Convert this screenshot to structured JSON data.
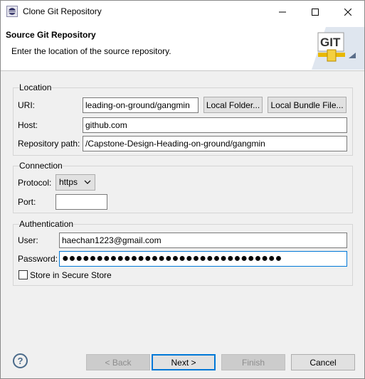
{
  "window": {
    "title": "Clone Git Repository",
    "controls": {
      "minimize": "—",
      "maximize": "☐",
      "close": "✕"
    }
  },
  "header": {
    "title": "Source Git Repository",
    "description": "Enter the location of the source repository.",
    "banner_text": "GIT"
  },
  "location": {
    "group_label": "Location",
    "uri_label": "URI:",
    "uri_value": "leading-on-ground/gangmin",
    "local_folder_button": "Local Folder...",
    "local_bundle_button": "Local Bundle File...",
    "host_label": "Host:",
    "host_value": "github.com",
    "repo_path_label": "Repository path:",
    "repo_path_value": "/Capstone-Design-Heading-on-ground/gangmin"
  },
  "connection": {
    "group_label": "Connection",
    "protocol_label": "Protocol:",
    "protocol_value": "https",
    "port_label": "Port:",
    "port_value": ""
  },
  "authentication": {
    "group_label": "Authentication",
    "user_label": "User:",
    "user_value": "haechan1223@gmail.com",
    "password_label": "Password:",
    "password_mask": "●●●●●●●●●●●●●●●●●●●●●●●●●●●●●●●●",
    "store_label": "Store in Secure Store",
    "store_checked": false
  },
  "footer": {
    "help": "?",
    "back": "< Back",
    "next": "Next >",
    "finish": "Finish",
    "cancel": "Cancel"
  },
  "colors": {
    "accent": "#0078d7",
    "banner_gold": "#e8b800"
  }
}
